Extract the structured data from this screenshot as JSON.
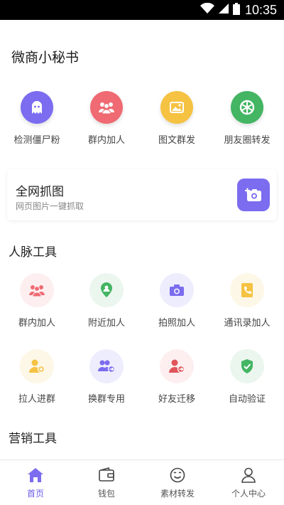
{
  "status_bar": {
    "time": "10:35"
  },
  "app": {
    "title": "微商小秘书"
  },
  "top_actions": [
    {
      "label": "检测僵尸粉",
      "icon": "ghost-icon",
      "color": "#7b6cf0"
    },
    {
      "label": "群内加人",
      "icon": "group-icon",
      "color": "#ef6a72"
    },
    {
      "label": "图文群发",
      "icon": "image-icon",
      "color": "#f5c242"
    },
    {
      "label": "朋友圈转发",
      "icon": "aperture-icon",
      "color": "#43b563"
    }
  ],
  "feature_card": {
    "title": "全网抓图",
    "subtitle": "网页图片一键抓取",
    "icon": "add-camera-icon",
    "color": "#7b6cf0"
  },
  "contacts_section": {
    "title": "人脉工具",
    "items": [
      {
        "label": "群内加人",
        "icon": "group-icon",
        "color": "#ef6a72",
        "bg": "#fdeff0"
      },
      {
        "label": "附近加人",
        "icon": "location-person-icon",
        "color": "#43b563",
        "bg": "#ebf6ee"
      },
      {
        "label": "拍照加人",
        "icon": "camera-icon",
        "color": "#7b6cf0",
        "bg": "#eeedfd"
      },
      {
        "label": "通讯录加人",
        "icon": "phone-book-icon",
        "color": "#f5c242",
        "bg": "#fdf7e7"
      },
      {
        "label": "拉人进群",
        "icon": "add-person-icon",
        "color": "#f5c242",
        "bg": "#fdf7e7"
      },
      {
        "label": "换群专用",
        "icon": "swap-group-icon",
        "color": "#7b6cf0",
        "bg": "#eeedfd"
      },
      {
        "label": "好友迁移",
        "icon": "transfer-person-icon",
        "color": "#e0555c",
        "bg": "#fdeff0"
      },
      {
        "label": "自动验证",
        "icon": "shield-check-icon",
        "color": "#43b563",
        "bg": "#ebf6ee"
      }
    ]
  },
  "marketing_section": {
    "title": "营销工具"
  },
  "tab_bar": [
    {
      "label": "首页",
      "icon": "home-icon",
      "active": true
    },
    {
      "label": "钱包",
      "icon": "wallet-icon",
      "active": false
    },
    {
      "label": "素材转发",
      "icon": "face-icon",
      "active": false
    },
    {
      "label": "个人中心",
      "icon": "person-icon",
      "active": false
    }
  ],
  "colors": {
    "accent": "#6b5be8",
    "text": "#222222",
    "subtext": "#888888"
  }
}
